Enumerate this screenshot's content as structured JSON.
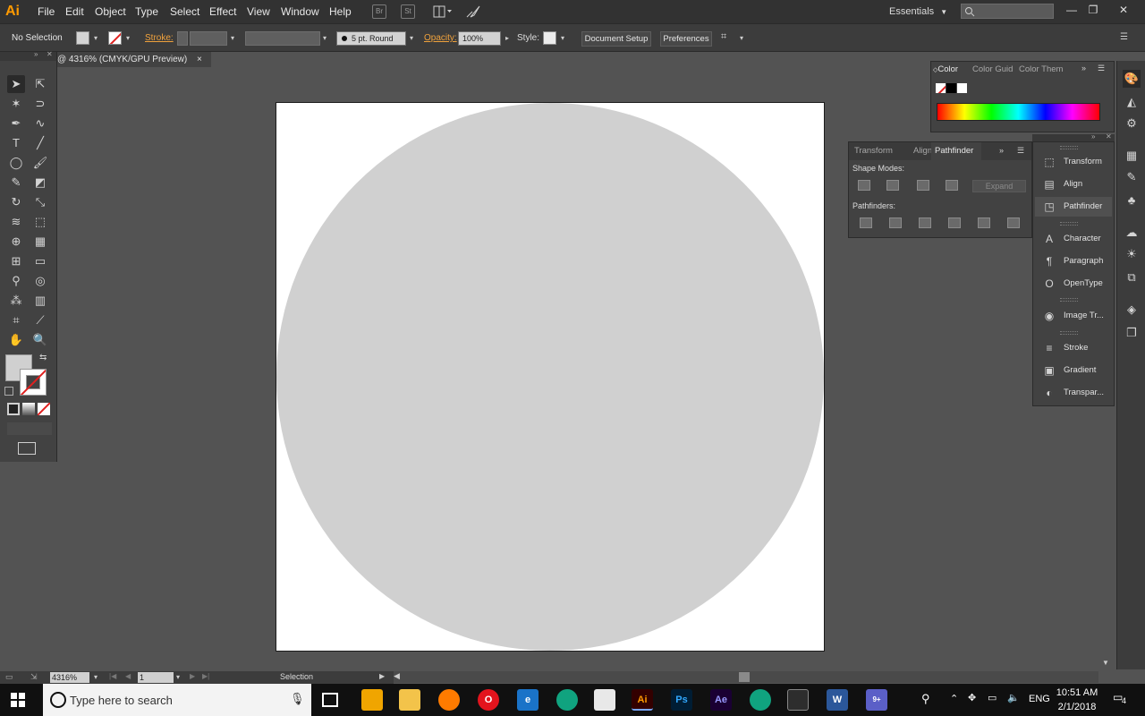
{
  "app": {
    "logo": "Ai",
    "accent": "#ff9a00"
  },
  "menu": [
    "File",
    "Edit",
    "Object",
    "Type",
    "Select",
    "Effect",
    "View",
    "Window",
    "Help"
  ],
  "menu_badges": [
    "Br",
    "St"
  ],
  "workspace": "Essentials",
  "control_bar": {
    "selection": "No Selection",
    "stroke_label": "Stroke:",
    "brush": "5 pt. Round",
    "opacity_label": "Opacity:",
    "opacity_value": "100%",
    "style_label": "Style:",
    "document_setup": "Document Setup",
    "preferences": "Preferences"
  },
  "document_tab": {
    "title": "@ 4316% (CMYK/GPU Preview)",
    "close": "×"
  },
  "color_panel": {
    "tabs": [
      "Color",
      "Color Guid",
      "Color Them"
    ]
  },
  "pathfinder_panel": {
    "tabs": [
      "Transform",
      "Align",
      "Pathfinder"
    ],
    "shape_modes_label": "Shape Modes:",
    "pathfinders_label": "Pathfinders:",
    "expand_label": "Expand"
  },
  "dock": [
    {
      "label": "Transform",
      "icon": "transform-icon"
    },
    {
      "label": "Align",
      "icon": "align-icon"
    },
    {
      "label": "Pathfinder",
      "icon": "pathfinder-icon",
      "selected": true
    },
    {
      "label": "Character",
      "icon": "character-icon"
    },
    {
      "label": "Paragraph",
      "icon": "paragraph-icon"
    },
    {
      "label": "OpenType",
      "icon": "opentype-icon"
    },
    {
      "label": "Image Tr...",
      "icon": "image-trace-icon"
    },
    {
      "label": "Stroke",
      "icon": "stroke-icon"
    },
    {
      "label": "Gradient",
      "icon": "gradient-icon"
    },
    {
      "label": "Transpar...",
      "icon": "transparency-icon"
    }
  ],
  "artwork": {
    "shape": "circle",
    "fill": "#d0d0d0",
    "artboard_color": "#ffffff"
  },
  "status_bar": {
    "zoom": "4316%",
    "page": "1",
    "tool": "Selection"
  },
  "taskbar": {
    "search_placeholder": "Type here to search",
    "language": "ENG",
    "time": "10:51 AM",
    "date": "2/1/2018",
    "notifications": "4",
    "apps": [
      {
        "name": "files-app-icon",
        "label": "",
        "color": "#f0a500"
      },
      {
        "name": "file-explorer-icon",
        "label": "",
        "color": "#f3c34a"
      },
      {
        "name": "firefox-icon",
        "label": "",
        "color": "#ff7b00"
      },
      {
        "name": "opera-icon",
        "label": "O",
        "color": "#e3141d"
      },
      {
        "name": "edge-icon",
        "label": "e",
        "color": "#1a73c8"
      },
      {
        "name": "chatgpt-icon",
        "label": "",
        "color": "#10a37f"
      },
      {
        "name": "mail-icon",
        "label": "",
        "color": "#e8e8e8"
      },
      {
        "name": "illustrator-icon",
        "label": "Ai",
        "color": "#330000"
      },
      {
        "name": "photoshop-icon",
        "label": "Ps",
        "color": "#001d34"
      },
      {
        "name": "after-effects-icon",
        "label": "Ae",
        "color": "#1a0033"
      },
      {
        "name": "chatgpt-icon-2",
        "label": "",
        "color": "#10a37f"
      },
      {
        "name": "terminal-icon",
        "label": "",
        "color": "#2d2d2d"
      },
      {
        "name": "word-icon",
        "label": "W",
        "color": "#2b579a"
      },
      {
        "name": "games-icon",
        "label": "9+",
        "color": "#5b5fc7"
      }
    ]
  }
}
